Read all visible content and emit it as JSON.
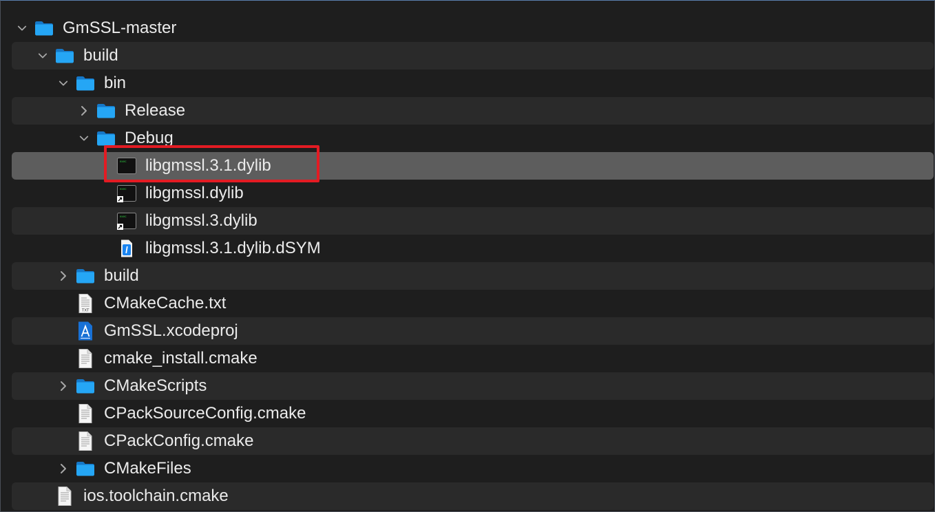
{
  "colors": {
    "background": "#1e1e1e",
    "row_alt": "#2a2a2a",
    "row_selected": "#5d5d5d",
    "folder_blue": "#1e9bf0",
    "annotation_red": "#e31b23"
  },
  "items": [
    {
      "label": "GmSSL-master",
      "depth": 0,
      "icon": "folder-icon",
      "disclosure": "expanded"
    },
    {
      "label": "build",
      "depth": 1,
      "icon": "folder-icon",
      "disclosure": "expanded"
    },
    {
      "label": "bin",
      "depth": 2,
      "icon": "folder-icon",
      "disclosure": "expanded"
    },
    {
      "label": "Release",
      "depth": 3,
      "icon": "folder-icon",
      "disclosure": "collapsed"
    },
    {
      "label": "Debug",
      "depth": 3,
      "icon": "folder-icon",
      "disclosure": "expanded"
    },
    {
      "label": "libgmssl.3.1.dylib",
      "depth": 4,
      "icon": "executable-icon",
      "disclosure": "none",
      "selected": true,
      "highlighted": true
    },
    {
      "label": "libgmssl.dylib",
      "depth": 4,
      "icon": "executable-alias-icon",
      "disclosure": "none"
    },
    {
      "label": "libgmssl.3.dylib",
      "depth": 4,
      "icon": "executable-alias-icon",
      "disclosure": "none"
    },
    {
      "label": "libgmssl.3.1.dylib.dSYM",
      "depth": 4,
      "icon": "dsym-icon",
      "disclosure": "none"
    },
    {
      "label": "build",
      "depth": 2,
      "icon": "folder-icon",
      "disclosure": "collapsed"
    },
    {
      "label": "CMakeCache.txt",
      "depth": 2,
      "icon": "txt-file-icon",
      "disclosure": "none"
    },
    {
      "label": "GmSSL.xcodeproj",
      "depth": 2,
      "icon": "xcodeproj-icon",
      "disclosure": "none"
    },
    {
      "label": "cmake_install.cmake",
      "depth": 2,
      "icon": "document-icon",
      "disclosure": "none"
    },
    {
      "label": "CMakeScripts",
      "depth": 2,
      "icon": "folder-icon",
      "disclosure": "collapsed"
    },
    {
      "label": "CPackSourceConfig.cmake",
      "depth": 2,
      "icon": "document-icon",
      "disclosure": "none"
    },
    {
      "label": "CPackConfig.cmake",
      "depth": 2,
      "icon": "document-icon",
      "disclosure": "none"
    },
    {
      "label": "CMakeFiles",
      "depth": 2,
      "icon": "folder-icon",
      "disclosure": "collapsed"
    },
    {
      "label": "ios.toolchain.cmake",
      "depth": 1,
      "icon": "document-icon",
      "disclosure": "none"
    }
  ]
}
